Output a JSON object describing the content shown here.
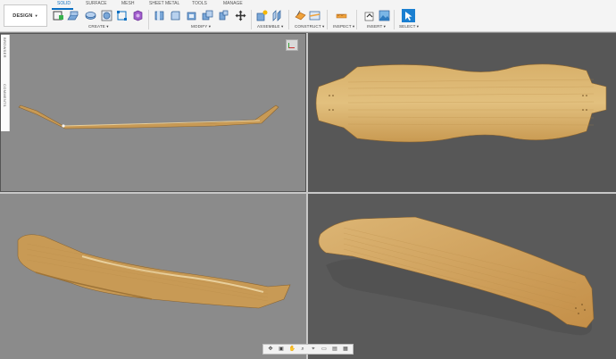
{
  "workspace": {
    "label": "DESIGN"
  },
  "tabs": [
    {
      "label": "SOLID",
      "active": true
    },
    {
      "label": "SURFACE"
    },
    {
      "label": "MESH"
    },
    {
      "label": "SHEET METAL"
    },
    {
      "label": "TOOLS"
    },
    {
      "label": "MANAGE"
    }
  ],
  "groups": {
    "create": "CREATE ▾",
    "modify": "MODIFY ▾",
    "assemble": "ASSEMBLE ▾",
    "construct": "CONSTRUCT ▾",
    "inspect": "INSPECT ▾",
    "insert": "INSERT ▾",
    "select": "SELECT ▾"
  },
  "side_panel": {
    "browser": "BROWSER",
    "comments": "COMMENTS"
  },
  "colors": {
    "accent": "#0a6fc2",
    "wood": "#c89a55",
    "wood_light": "#ddb877"
  },
  "icons": [
    "new-component-icon",
    "extrude-icon",
    "revolve-icon",
    "sketch-icon",
    "form-icon",
    "press-pull-icon",
    "fillet-icon",
    "shell-icon",
    "scale-icon",
    "move-icon",
    "new-joint-icon",
    "joint-icon",
    "offset-plane-icon",
    "section-analysis-icon",
    "measure-icon",
    "insert-mesh-icon",
    "insert-canvas-icon",
    "select-icon"
  ],
  "nav_bar": [
    "orbit-icon",
    "look-at-icon",
    "pan-icon",
    "zoom-icon",
    "fit-icon",
    "display-mode-icon",
    "visual-style-icon",
    "grid-icon"
  ]
}
